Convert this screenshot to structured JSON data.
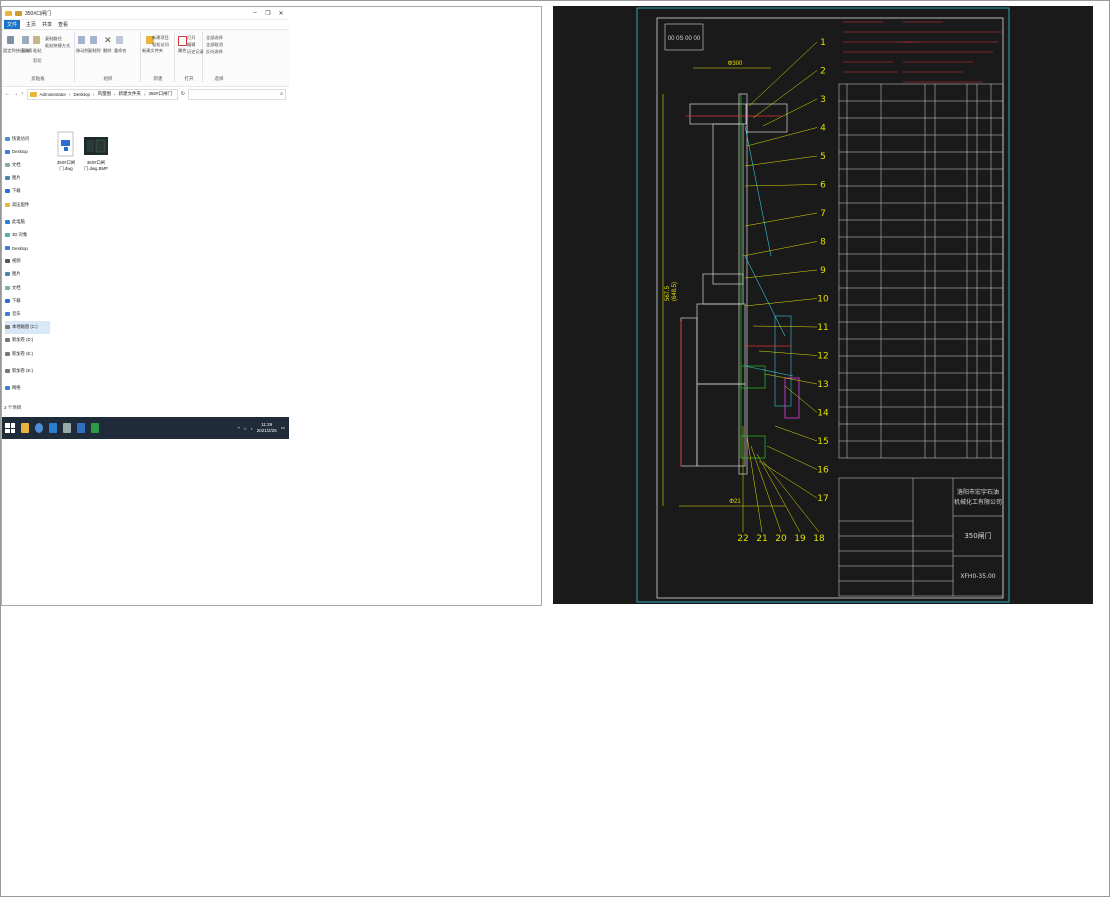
{
  "explorer": {
    "window_title": "350#口闸门",
    "menu": [
      "文件",
      "主页",
      "共享",
      "查看"
    ],
    "ribbon": {
      "groups": [
        "剪贴板",
        "组织",
        "新建",
        "打开",
        "选择"
      ],
      "buttons": [
        "固定到快速访问",
        "复制",
        "粘贴",
        "剪切",
        "复制路径",
        "粘贴快捷方式",
        "移动到",
        "复制到",
        "删除",
        "重命名",
        "新建文件夹",
        "新建项目",
        "轻松访问",
        "属性",
        "打开",
        "编辑",
        "历史记录",
        "全部选择",
        "全部取消",
        "反向选择"
      ]
    },
    "address": {
      "path": [
        "Administrator",
        "Desktop",
        "风量图",
        "新建文件夹",
        "350#口闸门"
      ]
    },
    "nav": {
      "items": [
        "快速访问",
        "Desktop",
        "文档",
        "图片",
        "下载",
        "高压配件",
        "此电脑",
        "3D 对象",
        "Desktop",
        "视频",
        "图片",
        "文档",
        "下载",
        "音乐",
        "本地磁盘 (C:)",
        "新加卷 (D:)",
        "新加卷 (E:)",
        "新加卷 (E:)",
        "网络"
      ]
    },
    "files": [
      {
        "name": "350#口闸门.dwg"
      },
      {
        "name": "350#口闸门.dwg.BMP"
      }
    ],
    "status": "2 个项目",
    "taskbar": {
      "time": "11:29",
      "date": "2021/2/26"
    }
  },
  "cad": {
    "stamp": "00 0S 00 00",
    "dims": {
      "top": "Φ300",
      "vertical": [
        "567.5",
        "(648.5)"
      ],
      "bottom": "Φ21"
    },
    "balloons": [
      "1",
      "2",
      "3",
      "4",
      "5",
      "6",
      "7",
      "8",
      "9",
      "10",
      "11",
      "12",
      "13",
      "14",
      "15",
      "16",
      "17",
      "18",
      "19",
      "20",
      "21",
      "22"
    ],
    "company_line1": "洛阳市宏宇石油",
    "company_line2": "机械化工有限公司",
    "part_name": "350闸门",
    "drawing_no": "XFH0-35.00",
    "colors": {
      "background": "#1a1a1a",
      "white": "#d8d8d8",
      "yellow": "#e0e000",
      "cyan": "#35c8d8",
      "green": "#28c028",
      "red": "#e03030",
      "magenta": "#e040e0"
    }
  }
}
